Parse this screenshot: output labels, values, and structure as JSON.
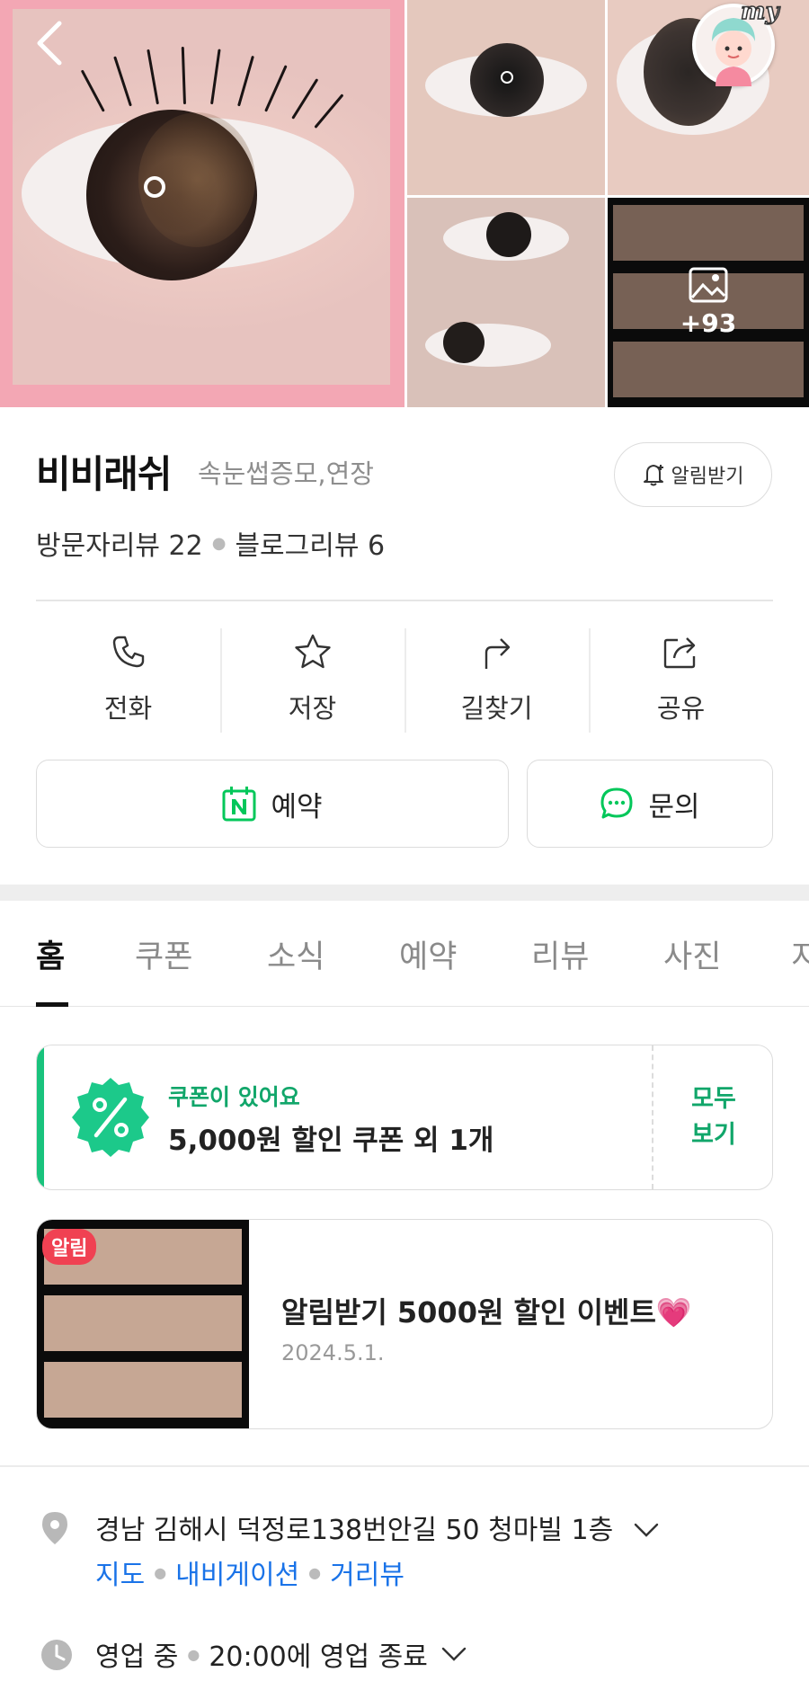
{
  "photos": {
    "more_count": "+93",
    "main_alt": "main-eyelash-photo"
  },
  "header": {
    "back_icon": "chevron-left-icon",
    "my_label": "my"
  },
  "place": {
    "name": "비비래쉬",
    "category": "속눈썹증모,연장",
    "notify_label": "알림받기",
    "visitor_reviews": "방문자리뷰 22",
    "blog_reviews": "블로그리뷰 6"
  },
  "actions": [
    {
      "label": "전화",
      "icon": "phone-icon"
    },
    {
      "label": "저장",
      "icon": "star-icon"
    },
    {
      "label": "길찾기",
      "icon": "directions-icon"
    },
    {
      "label": "공유",
      "icon": "share-icon"
    }
  ],
  "buttons": {
    "reserve": "예약",
    "inquiry": "문의"
  },
  "tabs": [
    "홈",
    "쿠폰",
    "소식",
    "예약",
    "리뷰",
    "사진",
    "지"
  ],
  "active_tab": "홈",
  "coupon": {
    "headline": "쿠폰이 있어요",
    "detail": "5,000원 할인 쿠폰 외 1개",
    "see_all_line1": "모두",
    "see_all_line2": "보기"
  },
  "news": {
    "tag": "알림",
    "title": "알림받기 5000원 할인 이벤트💗",
    "date": "2024.5.1."
  },
  "info": {
    "address": "경남 김해시 덕정로138번안길 50 청마빌 1층",
    "links": [
      "지도",
      "내비게이션",
      "거리뷰"
    ],
    "status": "영업 중",
    "hours": "20:00에 영업 종료"
  },
  "colors": {
    "accent_green": "#19c37d",
    "link_blue": "#1a73e8",
    "alert_red": "#f04152"
  }
}
